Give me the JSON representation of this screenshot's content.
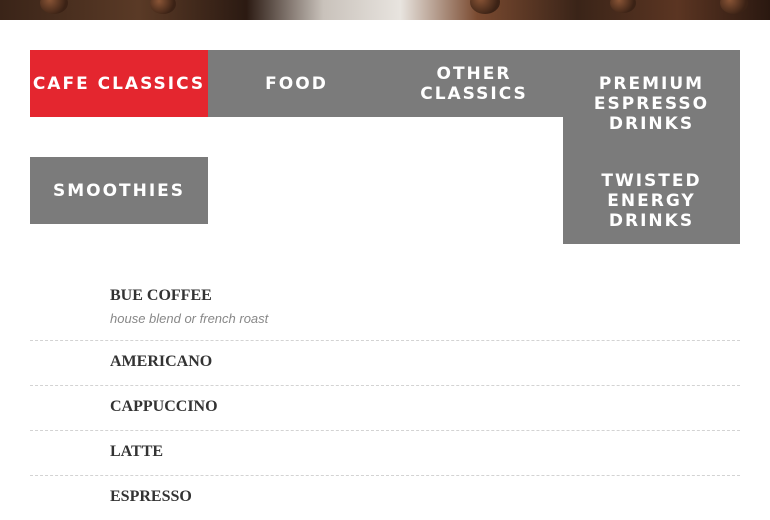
{
  "tabs": [
    {
      "label": "CAFE CLASSICS",
      "active": true
    },
    {
      "label": "FOOD",
      "active": false
    },
    {
      "label": "OTHER CLASSICS",
      "active": false
    },
    {
      "label": "PREMIUM ESPRESSO DRINKS",
      "active": false
    },
    {
      "label": "SMOOTHIES",
      "active": false
    },
    {
      "label": "TWISTED ENERGY DRINKS",
      "active": false
    }
  ],
  "menu_items": [
    {
      "name": "BUE COFFEE",
      "description": "house blend or french roast"
    },
    {
      "name": "AMERICANO"
    },
    {
      "name": "CAPPUCCINO"
    },
    {
      "name": "LATTE"
    },
    {
      "name": "ESPRESSO"
    }
  ],
  "colors": {
    "active_tab": "#e4262f",
    "inactive_tab": "#7b7b7b"
  }
}
